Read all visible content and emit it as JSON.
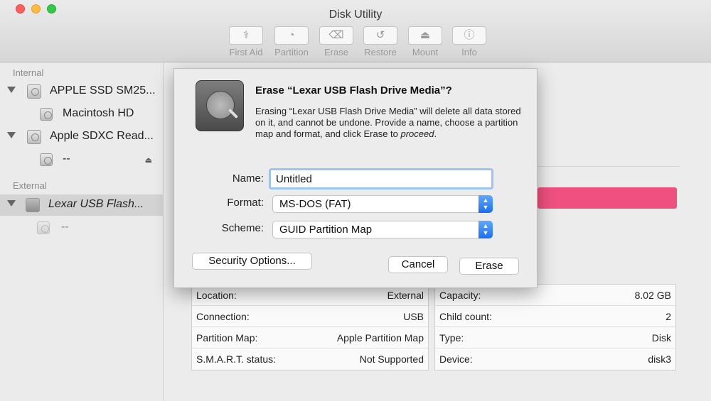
{
  "window": {
    "title": "Disk Utility"
  },
  "toolbar": {
    "items": [
      {
        "label": "First Aid",
        "icon": "stethoscope-icon",
        "glyph": "⚕"
      },
      {
        "label": "Partition",
        "icon": "pie-icon",
        "glyph": "◔"
      },
      {
        "label": "Erase",
        "icon": "erase-icon",
        "glyph": "⌫"
      },
      {
        "label": "Restore",
        "icon": "restore-icon",
        "glyph": "↺"
      },
      {
        "label": "Mount",
        "icon": "mount-icon",
        "glyph": "⏏"
      },
      {
        "label": "Info",
        "icon": "info-icon",
        "glyph": "ⓘ"
      }
    ]
  },
  "sidebar": {
    "internal_header": "Internal",
    "external_header": "External",
    "items": [
      {
        "label": "APPLE SSD SM25..."
      },
      {
        "label": "Macintosh HD"
      },
      {
        "label": "Apple SDXC Read..."
      },
      {
        "label": "--"
      },
      {
        "label": "Lexar USB Flash..."
      },
      {
        "label": "--"
      }
    ],
    "eject_glyph": "⏏"
  },
  "dialog": {
    "title": "Erase “Lexar USB Flash Drive Media”?",
    "body": "Erasing “Lexar USB Flash Drive Media” will delete all data stored on it, and cannot be undone. Provide a name, choose a partition map and format, and click Erase to",
    "body_em": "proceed",
    "body_end": ".",
    "name_label": "Name:",
    "name_value": "Untitled",
    "format_label": "Format:",
    "format_value": "MS-DOS (FAT)",
    "scheme_label": "Scheme:",
    "scheme_value": "GUID Partition Map",
    "security_button": "Security Options...",
    "cancel_button": "Cancel",
    "erase_button": "Erase"
  },
  "info": {
    "left": [
      {
        "key": "Location:",
        "value": "External"
      },
      {
        "key": "Connection:",
        "value": "USB"
      },
      {
        "key": "Partition Map:",
        "value": "Apple Partition Map"
      },
      {
        "key": "S.M.A.R.T. status:",
        "value": "Not Supported"
      }
    ],
    "right": [
      {
        "key": "Capacity:",
        "value": "8.02 GB"
      },
      {
        "key": "Child count:",
        "value": "2"
      },
      {
        "key": "Type:",
        "value": "Disk"
      },
      {
        "key": "Device:",
        "value": "disk3"
      }
    ]
  },
  "colors": {
    "usage_bar": "#f0507f",
    "accent": "#1a6ff0",
    "focus_ring": "#9ec3ee"
  }
}
